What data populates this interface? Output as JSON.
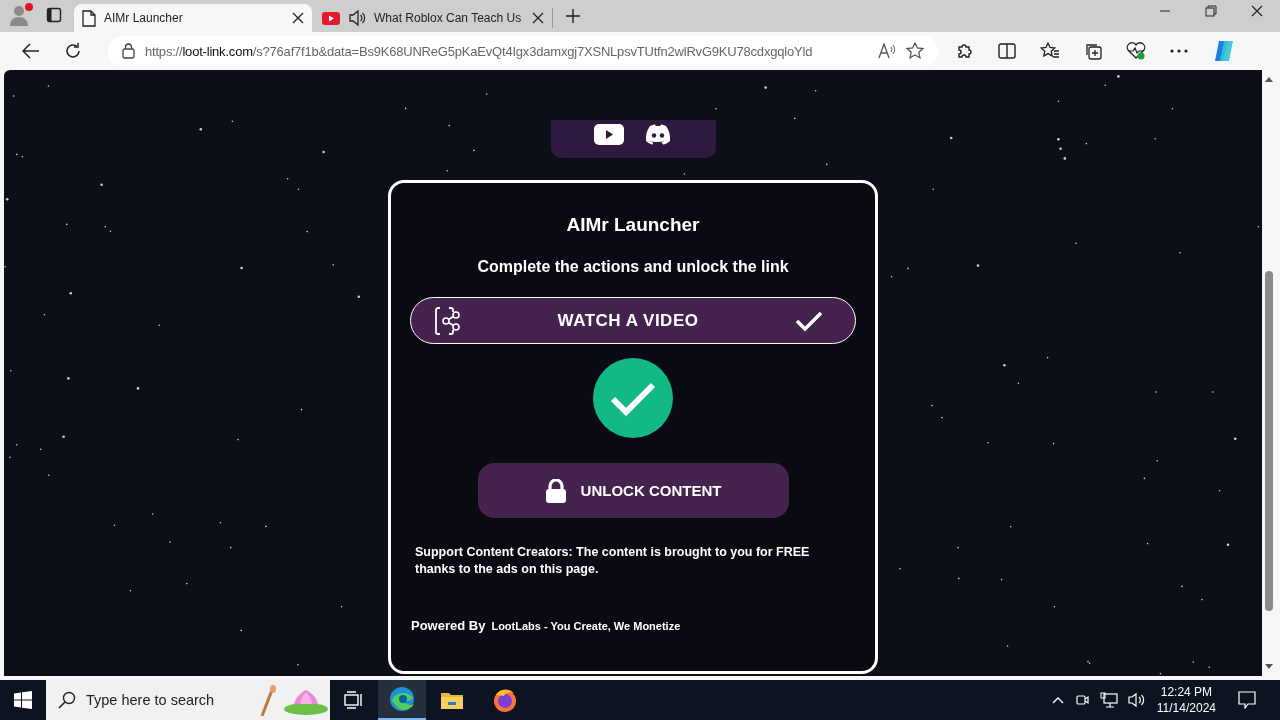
{
  "browser": {
    "tabs": [
      {
        "kind": "page",
        "title": "AIMr Launcher",
        "selected": true,
        "audio_playing": false
      },
      {
        "kind": "video",
        "title": "What Roblox Can Teach Us",
        "selected": false,
        "audio_playing": true
      }
    ],
    "address": {
      "scheme": "https://",
      "host": "loot-link.com",
      "path": "/s?76af7f1b&data=Bs9K68UNReG5pKaEvQt4Igx3damxgj7XSNLpsvTUtfn2wlRvG9KU78cdxgqloYld"
    }
  },
  "page": {
    "title": "AIMr Launcher",
    "subtitle": "Complete the actions and unlock the link",
    "tasks": [
      {
        "label": "WATCH A VIDEO",
        "done": true
      }
    ],
    "unlock_button": "UNLOCK CONTENT",
    "notice": "Support Content Creators: The content is brought to you for FREE thanks to the ads on this page.",
    "powered_by": "Powered By",
    "tagline": "LootLabs - You Create, We Monetize"
  },
  "taskbar": {
    "search_placeholder": "Type here to search",
    "time": "12:24 PM",
    "date": "11/14/2024"
  }
}
